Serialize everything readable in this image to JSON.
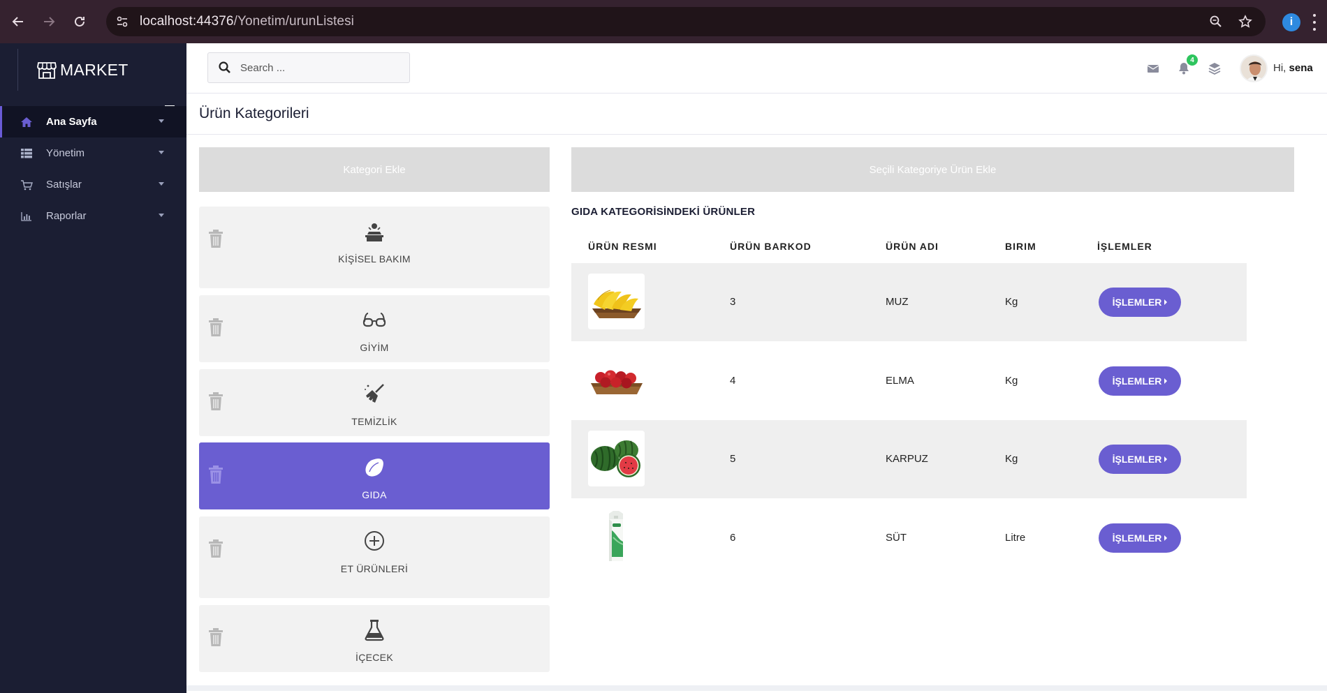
{
  "browser": {
    "url_host": "localhost:44376",
    "url_path": "/Yonetim/urunListesi",
    "profile_initial": "i"
  },
  "sidebar": {
    "brand": "MARKET",
    "items": [
      {
        "label": "Ana Sayfa",
        "icon": "home-icon",
        "active": true
      },
      {
        "label": "Yönetim",
        "icon": "list-icon",
        "active": false
      },
      {
        "label": "Satışlar",
        "icon": "cart-icon",
        "active": false
      },
      {
        "label": "Raporlar",
        "icon": "bar-chart-icon",
        "active": false
      }
    ]
  },
  "topbar": {
    "search_placeholder": "Search ...",
    "notification_count": "4",
    "greeting_prefix": "Hi,",
    "user_name": "sena"
  },
  "page": {
    "title": "Ürün Kategorileri",
    "add_category_label": "Kategori Ekle",
    "add_product_label": "Seçili Kategoriye Ürün Ekle",
    "section_title": "GIDA KATEGORİSİNDEKİ ÜRÜNLER"
  },
  "categories": [
    {
      "label": "KİŞİSEL BAKIM",
      "icon": "barber-icon",
      "active": false
    },
    {
      "label": "GİYİM",
      "icon": "glasses-icon",
      "active": false
    },
    {
      "label": "TEMİZLİK",
      "icon": "broom-icon",
      "active": false
    },
    {
      "label": "GIDA",
      "icon": "lemon-icon",
      "active": true
    },
    {
      "label": "ET ÜRÜNLERİ",
      "icon": "plus-circle-icon",
      "active": false
    },
    {
      "label": "İÇECEK",
      "icon": "flask-icon",
      "active": false
    }
  ],
  "table": {
    "headers": [
      "ÜRÜN RESMI",
      "ÜRÜN BARKOD",
      "ÜRÜN ADI",
      "BIRIM",
      "İŞLEMLER"
    ],
    "rows": [
      {
        "barcode": "3",
        "name": "MUZ",
        "unit": "Kg",
        "image": "banana-image",
        "action": "İŞLEMLER"
      },
      {
        "barcode": "4",
        "name": "ELMA",
        "unit": "Kg",
        "image": "apple-image",
        "action": "İŞLEMLER"
      },
      {
        "barcode": "5",
        "name": "KARPUZ",
        "unit": "Kg",
        "image": "watermelon-image",
        "action": "İŞLEMLER"
      },
      {
        "barcode": "6",
        "name": "SÜT",
        "unit": "Litre",
        "image": "milk-image",
        "action": "İŞLEMLER"
      }
    ]
  },
  "colors": {
    "accent": "#6a5ed1",
    "sidebar_bg": "#1b1e33",
    "browser_bg": "#35222f",
    "badge_green": "#2ec55e"
  }
}
